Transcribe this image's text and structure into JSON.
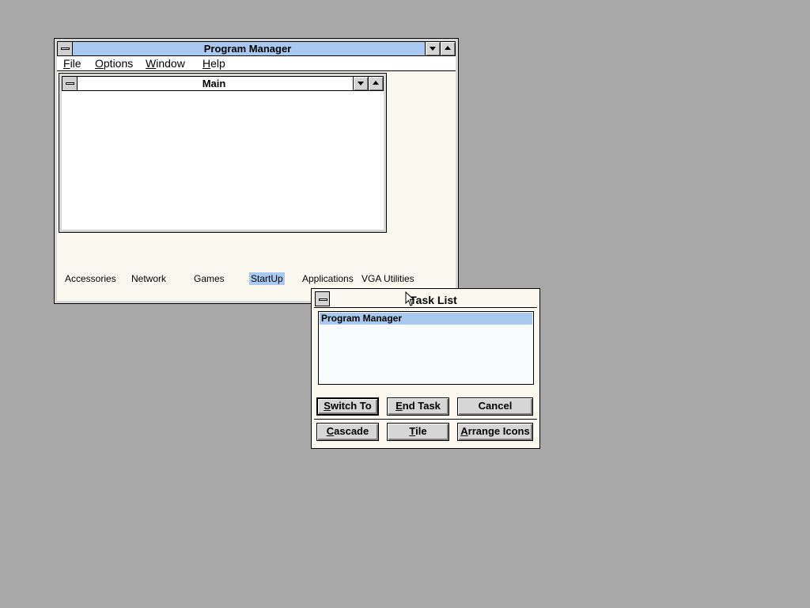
{
  "program_manager": {
    "title": "Program Manager",
    "menu": [
      "File",
      "Options",
      "Window",
      "Help"
    ],
    "main_group": {
      "title": "Main"
    },
    "group_icons": [
      {
        "label": "Accessories",
        "selected": false
      },
      {
        "label": "Network",
        "selected": false
      },
      {
        "label": "Games",
        "selected": false
      },
      {
        "label": "StartUp",
        "selected": true
      },
      {
        "label": "Applications",
        "selected": false
      },
      {
        "label": "VGA Utilities",
        "selected": false
      }
    ]
  },
  "task_list": {
    "title": "Task List",
    "items": [
      "Program Manager"
    ],
    "buttons": {
      "switch_to": {
        "mnemonic": "S",
        "rest": "witch To"
      },
      "end_task": {
        "mnemonic": "E",
        "rest": "nd Task"
      },
      "cancel": "Cancel",
      "cascade": {
        "mnemonic": "C",
        "rest": "ascade"
      },
      "tile": {
        "mnemonic": "T",
        "rest": "ile"
      },
      "arrange_icons": {
        "mnemonic": "A",
        "rest": "rrange Icons"
      }
    }
  },
  "colors": {
    "desktop": "#a8a8a8",
    "active_title": "#a9c9f0",
    "selection": "#a9c9f0",
    "button_face": "#d6d6d6"
  }
}
